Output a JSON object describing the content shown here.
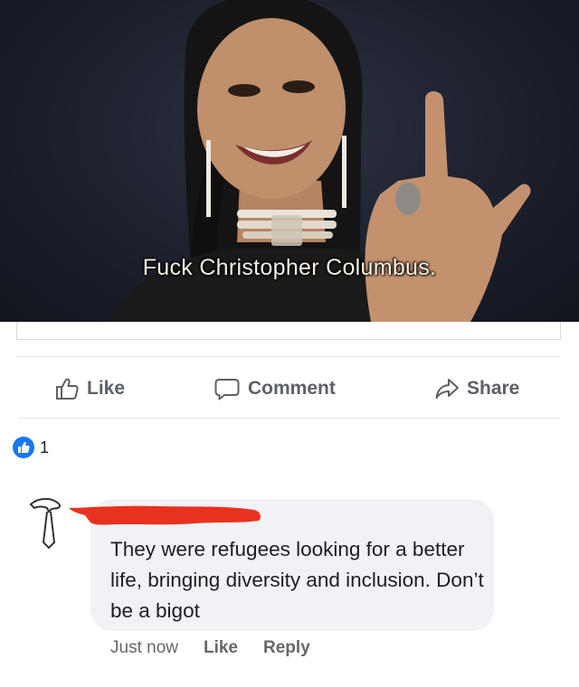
{
  "post": {
    "media": {
      "caption": "Fuck Christopher Columbus."
    },
    "actions": {
      "like_label": "Like",
      "comment_label": "Comment",
      "share_label": "Share"
    },
    "reactions": {
      "count": "1",
      "type_icon": "thumbs-up-icon",
      "color": "#1877f2"
    }
  },
  "comment": {
    "author_redacted": true,
    "text": "They were refugees looking for a better life, bringing diversity and inclusion. Don’t be a bigot",
    "timestamp": "Just now",
    "like_label": "Like",
    "reply_label": "Reply"
  },
  "colors": {
    "action_text": "#5c6068",
    "meta_text": "#65676b",
    "bubble_bg": "#f0f2f5",
    "redaction": "#e8321e"
  }
}
